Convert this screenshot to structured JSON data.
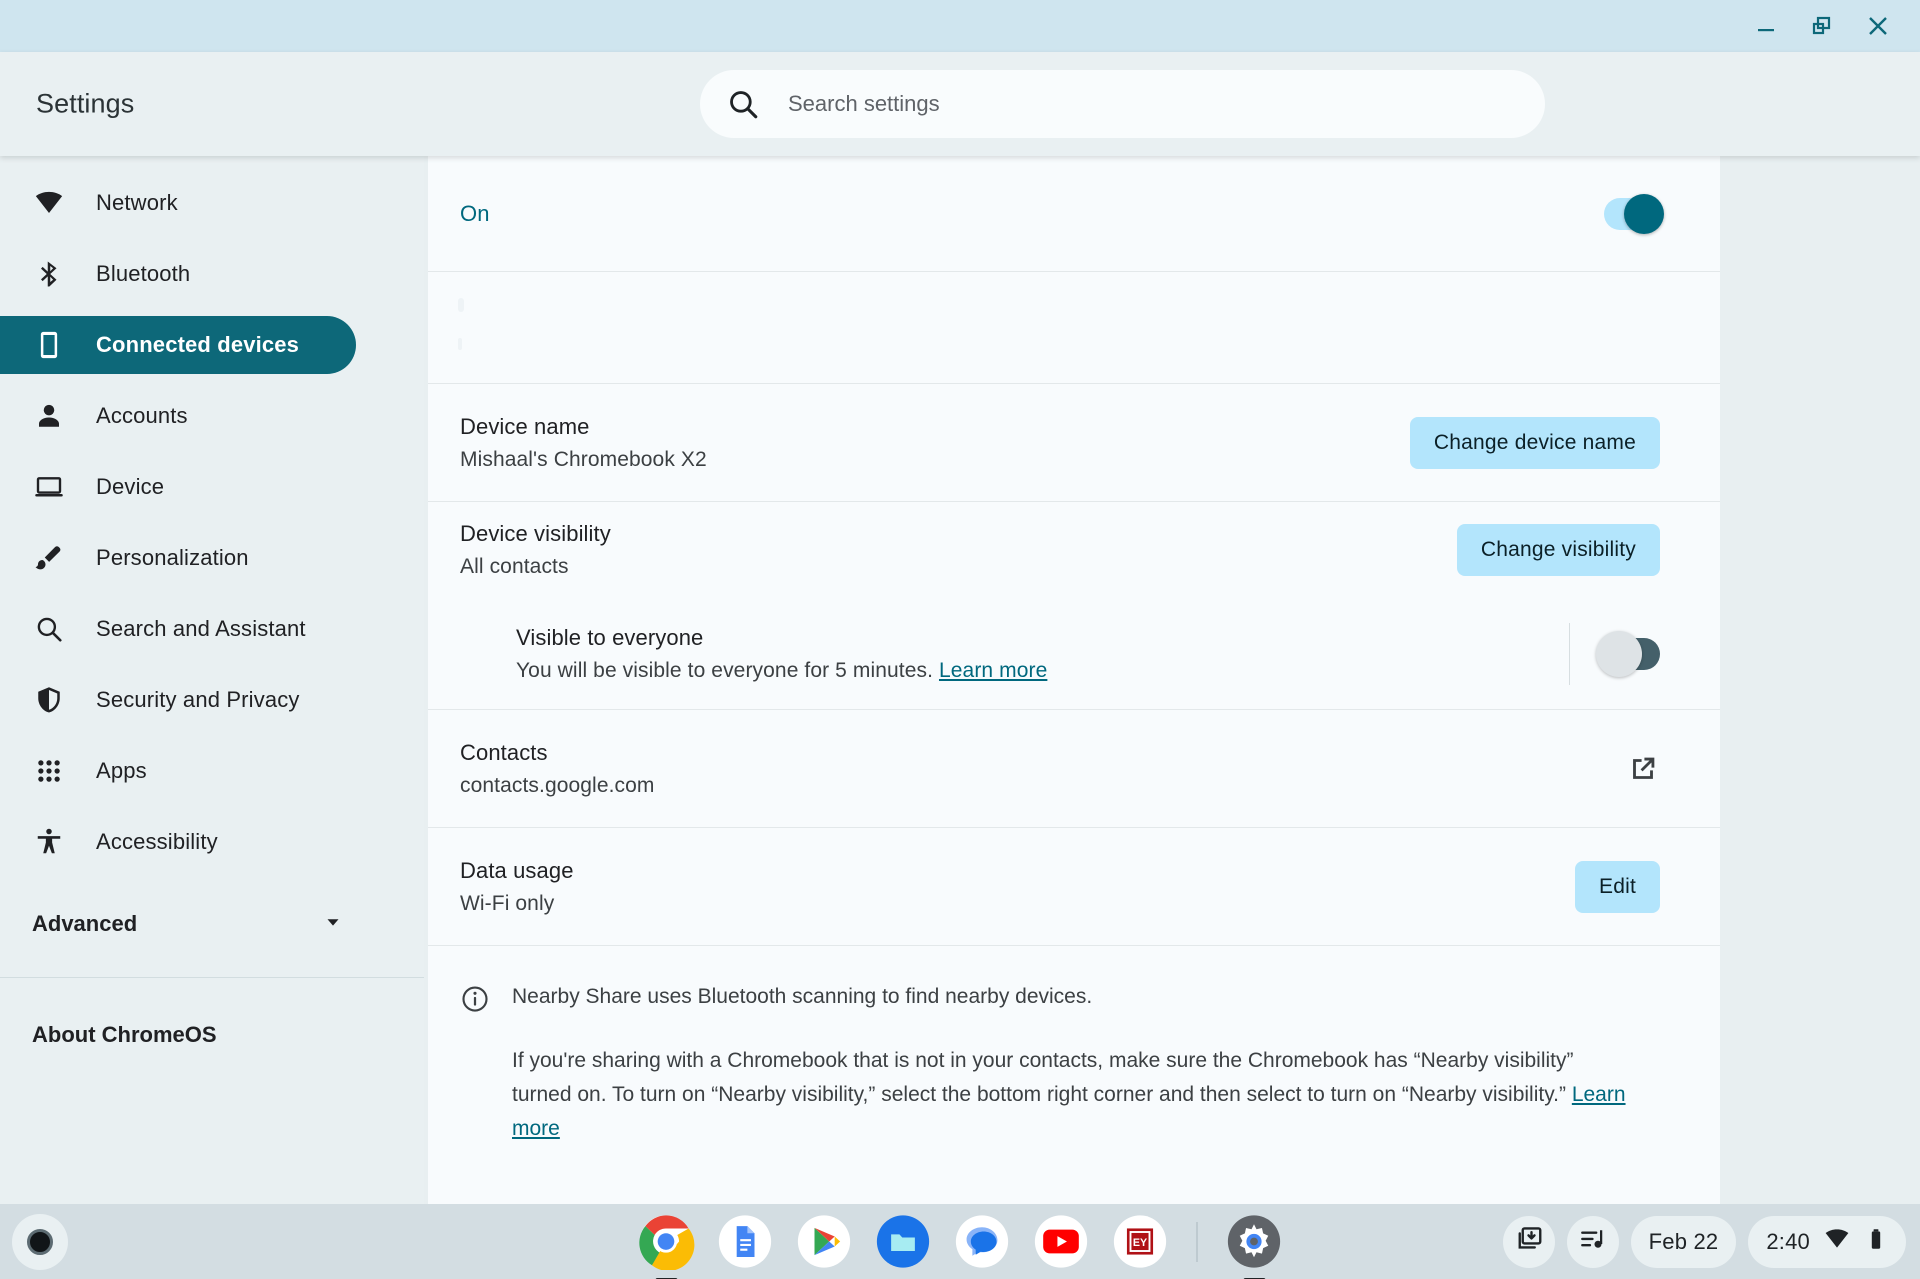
{
  "window": {
    "minimize_label": "Minimize",
    "restore_label": "Restore",
    "close_label": "Close"
  },
  "header": {
    "app_title": "Settings",
    "search_placeholder": "Search settings",
    "search_value": ""
  },
  "sidebar": {
    "items": [
      {
        "label": "Network",
        "icon": "wifi-icon",
        "selected": false
      },
      {
        "label": "Bluetooth",
        "icon": "bluetooth-icon",
        "selected": false
      },
      {
        "label": "Connected devices",
        "icon": "phone-icon",
        "selected": true
      },
      {
        "label": "Accounts",
        "icon": "person-icon",
        "selected": false
      },
      {
        "label": "Device",
        "icon": "laptop-icon",
        "selected": false
      },
      {
        "label": "Personalization",
        "icon": "brush-icon",
        "selected": false
      },
      {
        "label": "Search and Assistant",
        "icon": "search-icon",
        "selected": false
      },
      {
        "label": "Security and Privacy",
        "icon": "shield-icon",
        "selected": false
      },
      {
        "label": "Apps",
        "icon": "grid-icon",
        "selected": false
      },
      {
        "label": "Accessibility",
        "icon": "accessibility-icon",
        "selected": false
      }
    ],
    "advanced_label": "Advanced",
    "about_label": "About ChromeOS"
  },
  "main": {
    "status": {
      "label": "On",
      "toggle_state": "on"
    },
    "device_name": {
      "title": "Device name",
      "value": "Mishaal's Chromebook X2",
      "button": "Change device name"
    },
    "device_visibility": {
      "title": "Device visibility",
      "value": "All contacts",
      "button": "Change visibility"
    },
    "visible_to_everyone": {
      "title": "Visible to everyone",
      "description": "You will be visible to everyone for 5 minutes.",
      "link": "Learn more",
      "toggle_state": "off"
    },
    "contacts": {
      "title": "Contacts",
      "value": "contacts.google.com",
      "icon": "external-link-icon"
    },
    "data_usage": {
      "title": "Data usage",
      "value": "Wi-Fi only",
      "button": "Edit"
    },
    "info": {
      "icon": "info-icon",
      "paragraph1": "Nearby Share uses Bluetooth scanning to find nearby devices.",
      "paragraph2": "If you're sharing with a Chromebook that is not in your contacts, make sure the Chromebook has “Nearby visibility” turned on. To turn on “Nearby visibility,” select the bottom right corner and then select to turn on “Nearby visibility.” ",
      "link": "Learn more"
    }
  },
  "shelf": {
    "launcher": "launcher-button",
    "apps": [
      {
        "name": "chrome",
        "active": true
      },
      {
        "name": "docs",
        "active": false
      },
      {
        "name": "play-store",
        "active": false
      },
      {
        "name": "files",
        "active": false
      },
      {
        "name": "messages",
        "active": false
      },
      {
        "name": "youtube",
        "active": false
      },
      {
        "name": "ey",
        "active": false
      },
      {
        "name": "settings",
        "active": true
      }
    ],
    "tray": {
      "downloads_icon": "downloads-tote-icon",
      "media_icon": "media-playlist-icon",
      "date": "Feb 22",
      "time": "2:40",
      "wifi_icon": "wifi-icon",
      "battery_icon": "battery-icon"
    }
  },
  "colors": {
    "accent_teal": "#00687e",
    "selected_nav": "#0d6879",
    "button_blue": "#b3e5fc",
    "titlebar": "#cfe5ef",
    "sidebar_bg": "#e9f0f2",
    "content_bg": "#f8fbfd",
    "shelf_bg": "#d3dde2"
  }
}
